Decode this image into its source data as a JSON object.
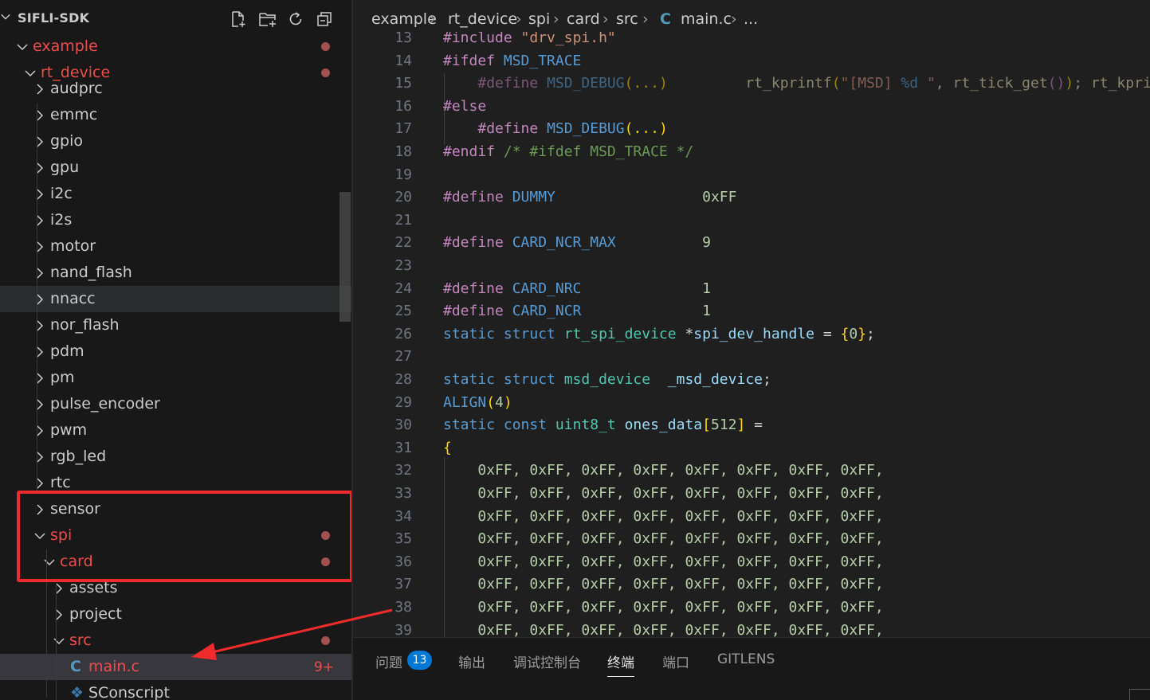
{
  "sidebar": {
    "title": "SIFLI-SDK",
    "actions": [
      {
        "name": "new-file-icon"
      },
      {
        "name": "new-folder-icon"
      },
      {
        "name": "refresh-icon"
      },
      {
        "name": "collapse-all-icon"
      }
    ],
    "tree": [
      {
        "label": "example",
        "level": 0,
        "expanded": true,
        "modified": true,
        "dot": true
      },
      {
        "label": "rt_device",
        "level": 1,
        "expanded": true,
        "modified": true,
        "dot": true
      },
      {
        "label": "audprc",
        "level": 2,
        "expanded": false
      },
      {
        "label": "emmc",
        "level": 2,
        "expanded": false
      },
      {
        "label": "gpio",
        "level": 2,
        "expanded": false
      },
      {
        "label": "gpu",
        "level": 2,
        "expanded": false
      },
      {
        "label": "i2c",
        "level": 2,
        "expanded": false
      },
      {
        "label": "i2s",
        "level": 2,
        "expanded": false
      },
      {
        "label": "motor",
        "level": 2,
        "expanded": false
      },
      {
        "label": "nand_flash",
        "level": 2,
        "expanded": false
      },
      {
        "label": "nnacc",
        "level": 2,
        "expanded": false,
        "hover": true
      },
      {
        "label": "nor_flash",
        "level": 2,
        "expanded": false
      },
      {
        "label": "pdm",
        "level": 2,
        "expanded": false
      },
      {
        "label": "pm",
        "level": 2,
        "expanded": false
      },
      {
        "label": "pulse_encoder",
        "level": 2,
        "expanded": false
      },
      {
        "label": "pwm",
        "level": 2,
        "expanded": false
      },
      {
        "label": "rgb_led",
        "level": 2,
        "expanded": false
      },
      {
        "label": "rtc",
        "level": 2,
        "expanded": false
      },
      {
        "label": "sensor",
        "level": 2,
        "expanded": false
      },
      {
        "label": "spi",
        "level": 2,
        "expanded": true,
        "modified": true,
        "dot": true
      },
      {
        "label": "card",
        "level": 3,
        "expanded": true,
        "modified": true,
        "dot": true
      },
      {
        "label": "assets",
        "level": 4,
        "expanded": false
      },
      {
        "label": "project",
        "level": 4,
        "expanded": false
      },
      {
        "label": "src",
        "level": 4,
        "expanded": true,
        "modified": true,
        "dot": true
      },
      {
        "label": "main.c",
        "level": 5,
        "file": "c",
        "modified": true,
        "selected": true,
        "badge": "9+"
      },
      {
        "label": "SConscript",
        "level": 5,
        "file": "py"
      }
    ]
  },
  "breadcrumb": {
    "items": [
      "example",
      "rt_device",
      "spi",
      "card",
      "src",
      "main.c",
      "..."
    ],
    "file_icon": "C"
  },
  "editor": {
    "lines": [
      {
        "n": "13",
        "tokens": [
          [
            "tk-pre",
            "#include "
          ],
          [
            "tk-str",
            "\"drv_spi.h\""
          ]
        ]
      },
      {
        "n": "14",
        "tokens": [
          [
            "tk-pre",
            "#ifdef "
          ],
          [
            "tk-macro",
            "MSD_TRACE"
          ]
        ]
      },
      {
        "n": "15",
        "tokens": [
          [
            "tk-op",
            "    "
          ],
          [
            "tk-pre tk-dim",
            "#define "
          ],
          [
            "tk-macro tk-dim",
            "MSD_DEBUG"
          ],
          [
            "tk-br tk-dim",
            "(...)"
          ],
          [
            "tk-op",
            "         "
          ],
          [
            "tk-fn tk-dim",
            "rt_kprintf"
          ],
          [
            "tk-br tk-dim",
            "("
          ],
          [
            "tk-str tk-dim",
            "\"[MSD] "
          ],
          [
            "tk-macro tk-dim",
            "%d"
          ],
          [
            "tk-str tk-dim",
            " \""
          ],
          [
            "tk-op tk-dim",
            ", "
          ],
          [
            "tk-fn tk-dim",
            "rt_tick_get"
          ],
          [
            "tk-br2 tk-dim",
            "()"
          ],
          [
            "tk-br tk-dim",
            ")"
          ],
          [
            "tk-op tk-dim",
            "; "
          ],
          [
            "tk-fn tk-dim",
            "rt_kprintf"
          ]
        ]
      },
      {
        "n": "16",
        "tokens": [
          [
            "tk-pre",
            "#else"
          ]
        ]
      },
      {
        "n": "17",
        "tokens": [
          [
            "tk-op",
            "    "
          ],
          [
            "tk-pre",
            "#define "
          ],
          [
            "tk-macro",
            "MSD_DEBUG"
          ],
          [
            "tk-br",
            "(...)"
          ]
        ]
      },
      {
        "n": "18",
        "tokens": [
          [
            "tk-pre",
            "#endif "
          ],
          [
            "tk-com",
            "/* #ifdef MSD_TRACE */"
          ]
        ]
      },
      {
        "n": "19",
        "tokens": []
      },
      {
        "n": "20",
        "tokens": [
          [
            "tk-pre",
            "#define "
          ],
          [
            "tk-macro",
            "DUMMY"
          ],
          [
            "tk-op",
            "                 "
          ],
          [
            "tk-num",
            "0xFF"
          ]
        ]
      },
      {
        "n": "21",
        "tokens": []
      },
      {
        "n": "22",
        "tokens": [
          [
            "tk-pre",
            "#define "
          ],
          [
            "tk-macro",
            "CARD_NCR_MAX"
          ],
          [
            "tk-op",
            "          "
          ],
          [
            "tk-num",
            "9"
          ]
        ]
      },
      {
        "n": "23",
        "tokens": []
      },
      {
        "n": "24",
        "tokens": [
          [
            "tk-pre",
            "#define "
          ],
          [
            "tk-macro",
            "CARD_NRC"
          ],
          [
            "tk-op",
            "              "
          ],
          [
            "tk-num",
            "1"
          ]
        ]
      },
      {
        "n": "25",
        "tokens": [
          [
            "tk-pre",
            "#define "
          ],
          [
            "tk-macro",
            "CARD_NCR"
          ],
          [
            "tk-op",
            "              "
          ],
          [
            "tk-num",
            "1"
          ]
        ]
      },
      {
        "n": "26",
        "tokens": [
          [
            "tk-kw",
            "static "
          ],
          [
            "tk-kw",
            "struct "
          ],
          [
            "tk-type",
            "rt_spi_device "
          ],
          [
            "tk-op",
            "*"
          ],
          [
            "tk-var",
            "spi_dev_handle"
          ],
          [
            "tk-op",
            " = "
          ],
          [
            "tk-br",
            "{"
          ],
          [
            "tk-num",
            "0"
          ],
          [
            "tk-br",
            "}"
          ],
          [
            "tk-op",
            ";"
          ]
        ]
      },
      {
        "n": "27",
        "tokens": []
      },
      {
        "n": "28",
        "tokens": [
          [
            "tk-kw",
            "static "
          ],
          [
            "tk-kw",
            "struct "
          ],
          [
            "tk-type",
            "msd_device"
          ],
          [
            "tk-op",
            "  "
          ],
          [
            "tk-var",
            "_msd_device"
          ],
          [
            "tk-op",
            ";"
          ]
        ]
      },
      {
        "n": "29",
        "tokens": [
          [
            "tk-macro",
            "ALIGN"
          ],
          [
            "tk-br",
            "("
          ],
          [
            "tk-num",
            "4"
          ],
          [
            "tk-br",
            ")"
          ]
        ]
      },
      {
        "n": "30",
        "tokens": [
          [
            "tk-kw",
            "static "
          ],
          [
            "tk-kw",
            "const "
          ],
          [
            "tk-type",
            "uint8_t "
          ],
          [
            "tk-var",
            "ones_data"
          ],
          [
            "tk-br",
            "["
          ],
          [
            "tk-num",
            "512"
          ],
          [
            "tk-br",
            "]"
          ],
          [
            "tk-op",
            " ="
          ]
        ]
      },
      {
        "n": "31",
        "tokens": [
          [
            "tk-br",
            "{"
          ]
        ]
      },
      {
        "n": "32",
        "tokens": [
          [
            "tk-op",
            "    "
          ],
          [
            "tk-num",
            "0xFF, 0xFF, 0xFF, 0xFF, 0xFF, 0xFF, 0xFF, 0xFF,"
          ]
        ]
      },
      {
        "n": "33",
        "tokens": [
          [
            "tk-op",
            "    "
          ],
          [
            "tk-num",
            "0xFF, 0xFF, 0xFF, 0xFF, 0xFF, 0xFF, 0xFF, 0xFF,"
          ]
        ]
      },
      {
        "n": "34",
        "tokens": [
          [
            "tk-op",
            "    "
          ],
          [
            "tk-num",
            "0xFF, 0xFF, 0xFF, 0xFF, 0xFF, 0xFF, 0xFF, 0xFF,"
          ]
        ]
      },
      {
        "n": "35",
        "tokens": [
          [
            "tk-op",
            "    "
          ],
          [
            "tk-num",
            "0xFF, 0xFF, 0xFF, 0xFF, 0xFF, 0xFF, 0xFF, 0xFF,"
          ]
        ]
      },
      {
        "n": "36",
        "tokens": [
          [
            "tk-op",
            "    "
          ],
          [
            "tk-num",
            "0xFF, 0xFF, 0xFF, 0xFF, 0xFF, 0xFF, 0xFF, 0xFF,"
          ]
        ]
      },
      {
        "n": "37",
        "tokens": [
          [
            "tk-op",
            "    "
          ],
          [
            "tk-num",
            "0xFF, 0xFF, 0xFF, 0xFF, 0xFF, 0xFF, 0xFF, 0xFF,"
          ]
        ]
      },
      {
        "n": "38",
        "tokens": [
          [
            "tk-op",
            "    "
          ],
          [
            "tk-num",
            "0xFF, 0xFF, 0xFF, 0xFF, 0xFF, 0xFF, 0xFF, 0xFF,"
          ]
        ]
      },
      {
        "n": "39",
        "tokens": [
          [
            "tk-op",
            "    "
          ],
          [
            "tk-num",
            "0xFF, 0xFF, 0xFF, 0xFF, 0xFF, 0xFF, 0xFF, 0xFF,"
          ]
        ]
      }
    ]
  },
  "panel": {
    "tabs": [
      {
        "label": "问题",
        "badge": "13",
        "name": "tab-problems"
      },
      {
        "label": "输出",
        "name": "tab-output"
      },
      {
        "label": "调试控制台",
        "name": "tab-debug-console"
      },
      {
        "label": "终端",
        "name": "tab-terminal",
        "active": true
      },
      {
        "label": "端口",
        "name": "tab-ports"
      },
      {
        "label": "GITLENS",
        "name": "tab-gitlens"
      }
    ]
  },
  "colors": {
    "accent": "#0078d4",
    "modified": "#f14c4c",
    "annotation": "#f12b2b"
  }
}
